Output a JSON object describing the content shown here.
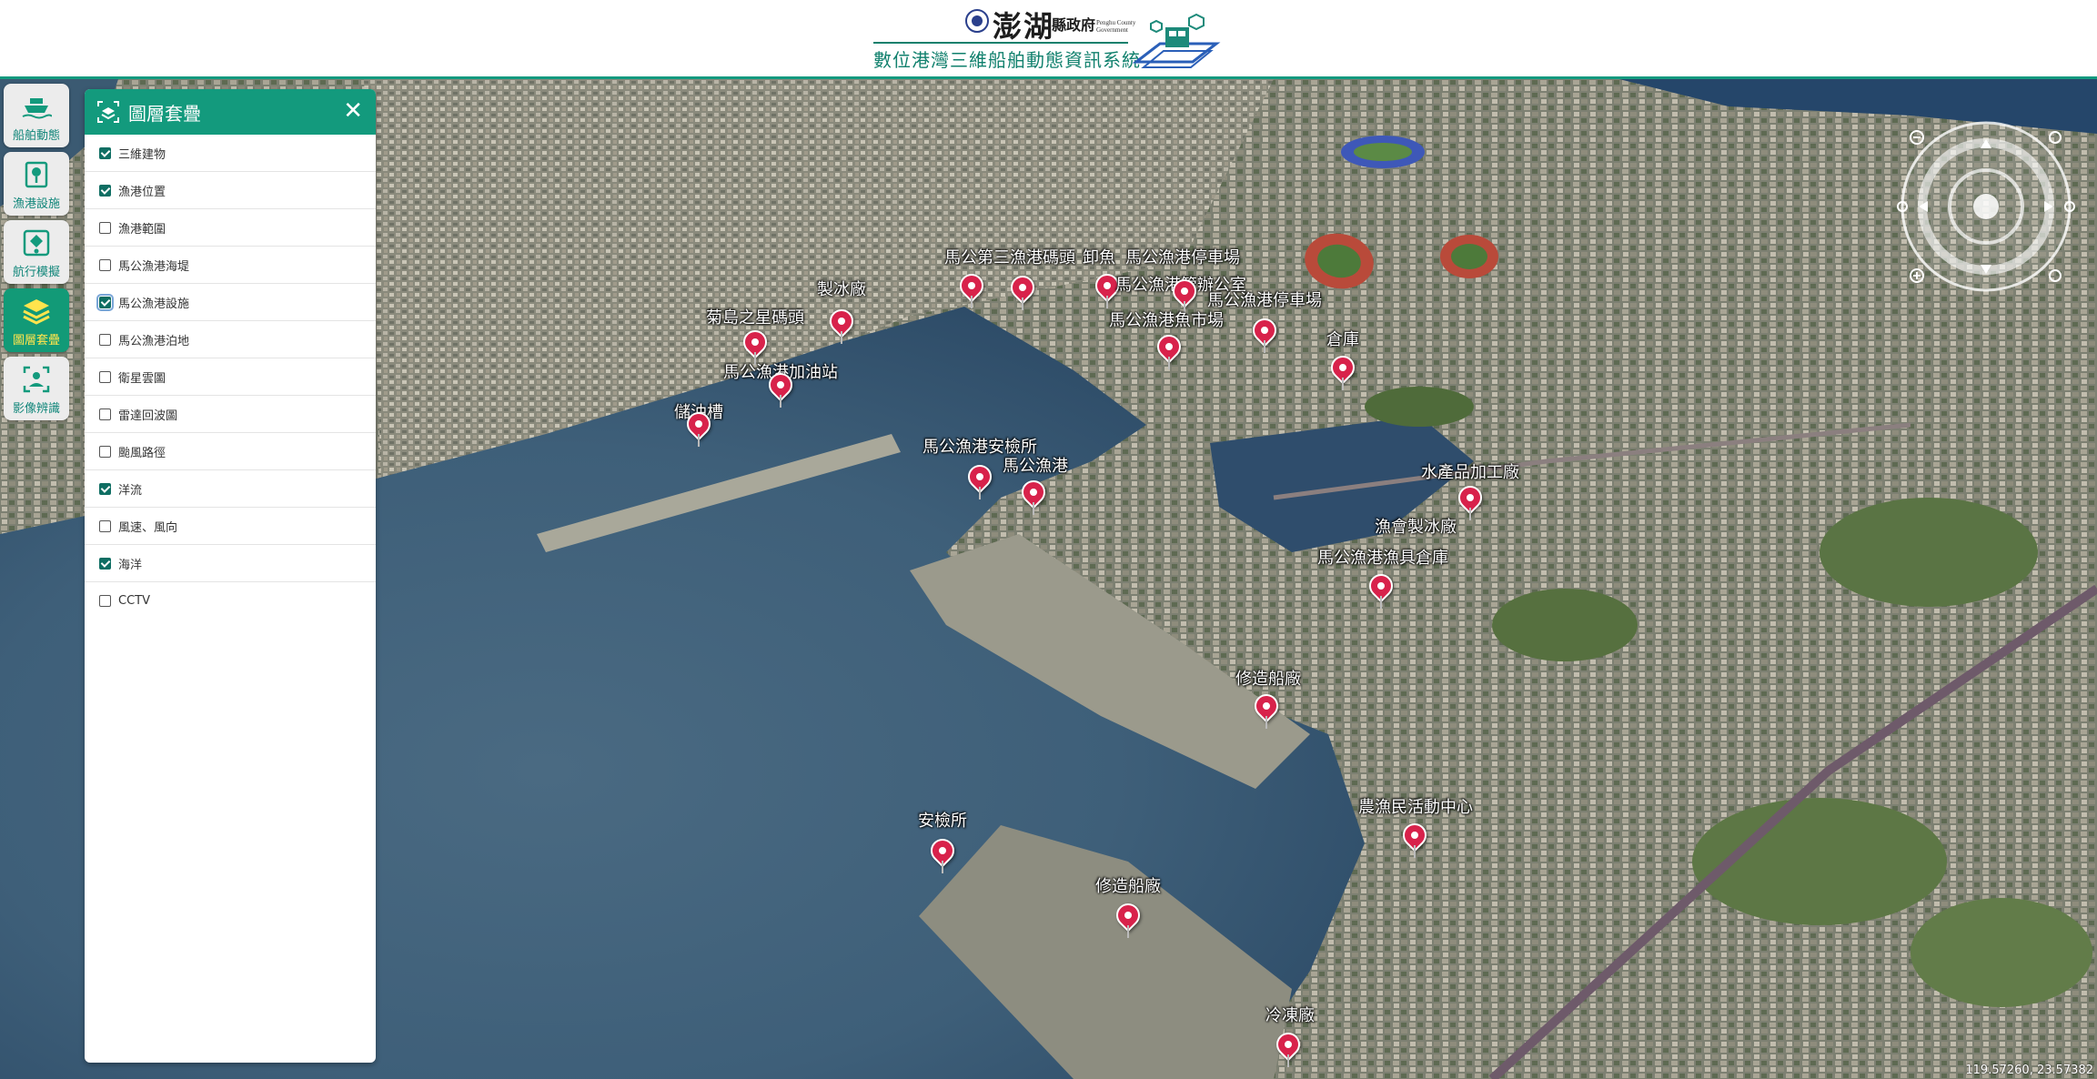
{
  "header": {
    "logo_text": "澎湖",
    "logo_gov": "縣政府",
    "logo_en": "Penghu County Government",
    "system_title": "數位港灣三維船舶動態資訊系統"
  },
  "toolbar": {
    "items": [
      {
        "label": "船舶動態",
        "icon": "ship-icon",
        "active": false
      },
      {
        "label": "漁港設施",
        "icon": "port-facility-icon",
        "active": false
      },
      {
        "label": "航行模擬",
        "icon": "navigation-sim-icon",
        "active": false
      },
      {
        "label": "圖層套疊",
        "icon": "layers-icon",
        "active": true
      },
      {
        "label": "影像辨識",
        "icon": "image-recognition-icon",
        "active": false
      }
    ]
  },
  "panel": {
    "title": "圖層套疊",
    "close_label": "✕",
    "layers": [
      {
        "label": "三維建物",
        "checked": true
      },
      {
        "label": "漁港位置",
        "checked": true
      },
      {
        "label": "漁港範圍",
        "checked": false
      },
      {
        "label": "馬公漁港海堤",
        "checked": false
      },
      {
        "label": "馬公漁港設施",
        "checked": true
      },
      {
        "label": "馬公漁港泊地",
        "checked": false
      },
      {
        "label": "衛星雲圖",
        "checked": false
      },
      {
        "label": "雷達回波圖",
        "checked": false
      },
      {
        "label": "颱風路徑",
        "checked": false
      },
      {
        "label": "洋流",
        "checked": true
      },
      {
        "label": "風速、風向",
        "checked": false
      },
      {
        "label": "海洋",
        "checked": true
      },
      {
        "label": "CCTV",
        "checked": false
      }
    ]
  },
  "map": {
    "markers": [
      {
        "label": "製冰廠"
      },
      {
        "label": "菊島之星碼頭"
      },
      {
        "label": "馬公漁港加油站"
      },
      {
        "label": "儲油槽"
      },
      {
        "label": "馬公第三漁港碼頭"
      },
      {
        "label": "卸魚"
      },
      {
        "label": "馬公漁港停車場"
      },
      {
        "label": "馬公漁港管辦公室"
      },
      {
        "label": "馬公漁港停車場"
      },
      {
        "label": "馬公漁港魚市場"
      },
      {
        "label": "倉庫"
      },
      {
        "label": "馬公漁港安檢所"
      },
      {
        "label": "馬公漁港"
      },
      {
        "label": "水產品加工廠"
      },
      {
        "label": "漁會製冰廠"
      },
      {
        "label": "馬公漁港漁具倉庫"
      },
      {
        "label": "修造船廠"
      },
      {
        "label": "農漁民活動中心"
      },
      {
        "label": "安檢所"
      },
      {
        "label": "修造船廠"
      },
      {
        "label": "冷凍廠"
      }
    ],
    "coords": "119.57260, 23.57382"
  },
  "colors": {
    "accent": "#139a7d",
    "marker": "#d8224b",
    "active_label": "#ffe44d"
  }
}
